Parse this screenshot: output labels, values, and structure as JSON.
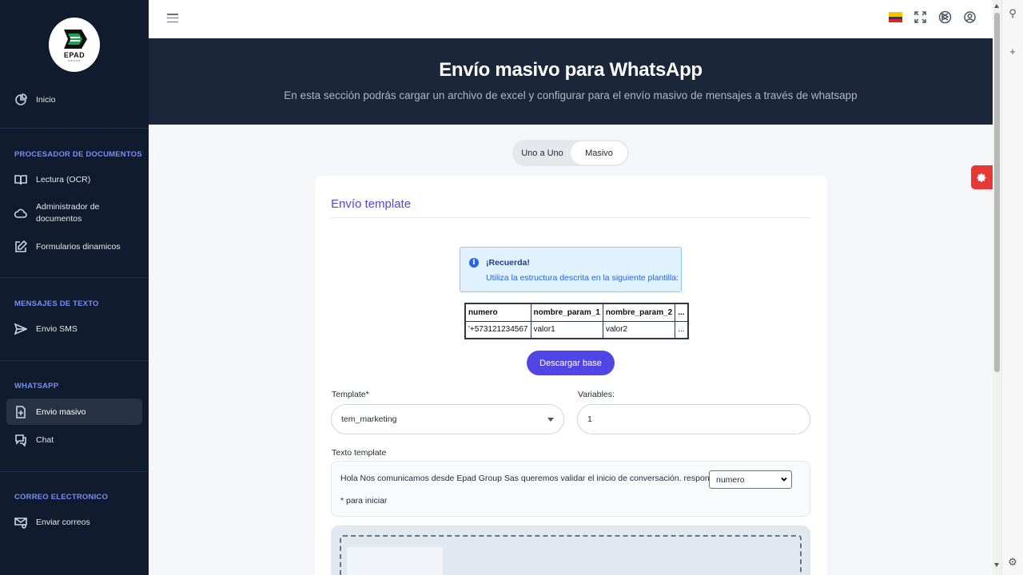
{
  "brand": {
    "logo_text": "EPAD",
    "logo_sub": "GROUP"
  },
  "sidebar": {
    "home": {
      "label": "Inicio",
      "icon": "pie-chart-icon"
    },
    "sections": [
      {
        "title": "PROCESADOR DE DOCUMENTOS",
        "items": [
          {
            "label": "Lectura (OCR)",
            "icon": "book-icon"
          },
          {
            "label": "Administrador de documentos",
            "icon": "cloud-icon"
          },
          {
            "label": "Formularios dinamicos",
            "icon": "edit-icon"
          }
        ]
      },
      {
        "title": "MENSAJES DE TEXTO",
        "items": [
          {
            "label": "Envio SMS",
            "icon": "send-icon"
          }
        ]
      },
      {
        "title": "WHATSAPP",
        "items": [
          {
            "label": "Envio masivo",
            "icon": "file-plus-icon",
            "active": true
          },
          {
            "label": "Chat",
            "icon": "chat-icon"
          }
        ]
      },
      {
        "title": "CORREO ELECTRONICO",
        "items": [
          {
            "label": "Enviar correos",
            "icon": "mail-icon"
          }
        ]
      }
    ]
  },
  "hero": {
    "title": "Envío masivo para WhatsApp",
    "subtitle": "En esta sección podrás cargar un archivo de excel y configurar para el envío masivo de mensajes a través de whatsapp"
  },
  "toggle": {
    "options": [
      "Uno a Uno",
      "Masivo"
    ],
    "selected": "Masivo"
  },
  "card": {
    "title": "Envío template",
    "alert": {
      "title": "¡Recuerda!",
      "text": "Utiliza la estructura descrita en la siguiente plantilla:"
    },
    "table": {
      "headers": [
        "numero",
        "nombre_param_1",
        "nombre_param_2",
        "..."
      ],
      "rows": [
        [
          "'+573121234567",
          "valor1",
          "valor2",
          "..."
        ]
      ]
    },
    "download_button": "Descargar base",
    "template_label": "Template*",
    "template_value": "tem_marketing",
    "variables_label": "Variables:",
    "variables_value": "1",
    "texto_label": "Texto template",
    "texto_line1": "Hola Nos comunicamos desde Epad Group Sas queremos validar el inicio de conversación. responde *",
    "texto_select": "numero",
    "texto_line2": "* para iniciar"
  },
  "colors": {
    "sidebar_bg": "#111b2e",
    "accent": "#4f46e5",
    "hero_bg": "#1b2638",
    "fab": "#e53935"
  }
}
